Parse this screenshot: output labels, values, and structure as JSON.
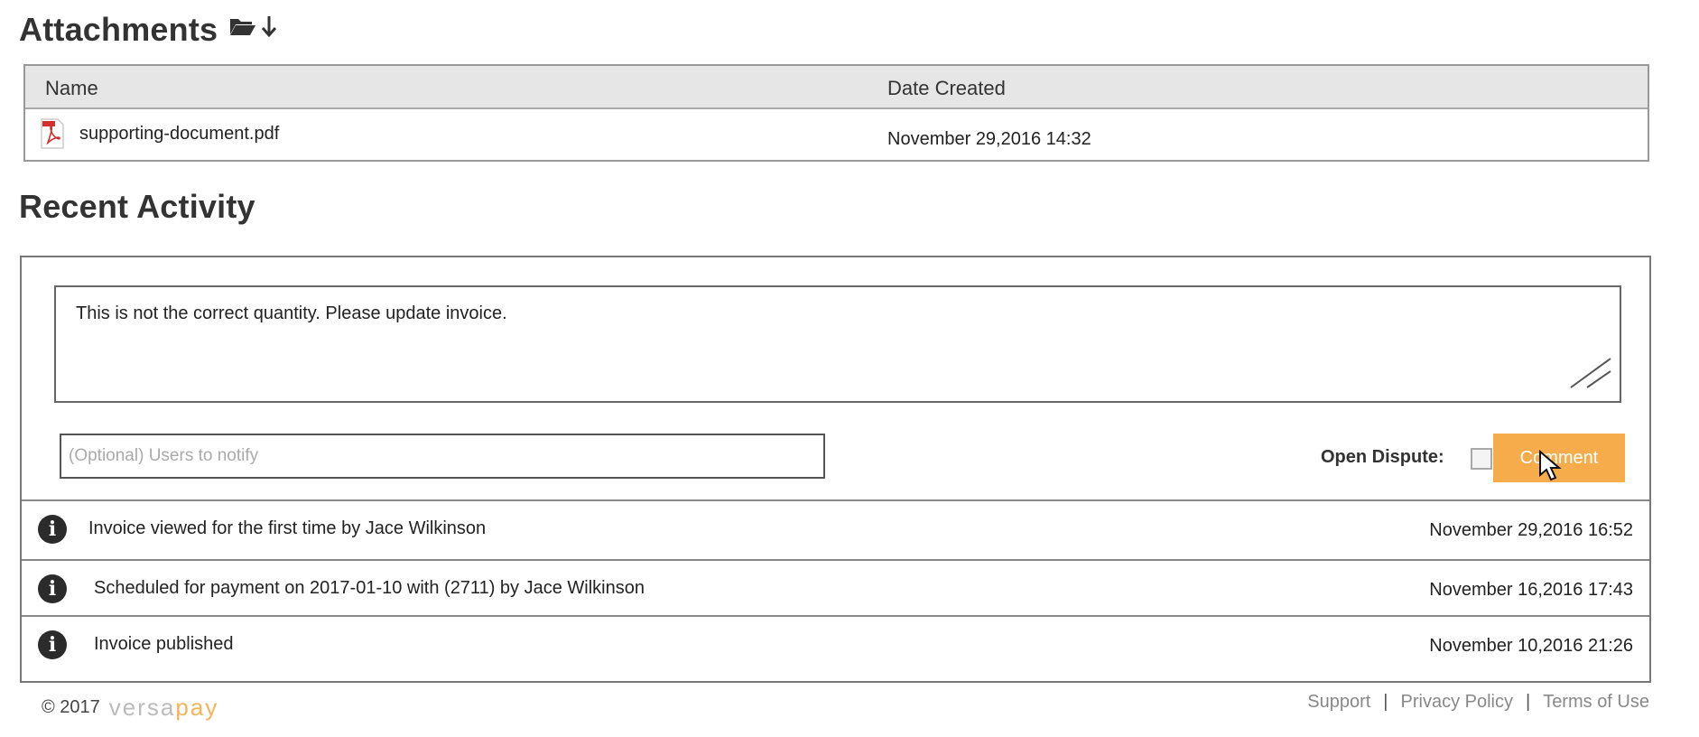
{
  "attachments": {
    "title": "Attachments",
    "columns": {
      "name": "Name",
      "date": "Date Created"
    },
    "files": [
      {
        "name": "supporting-document.pdf",
        "date": "November 29,2016  14:32"
      }
    ]
  },
  "recent_activity": {
    "title": "Recent Activity",
    "comment_text": "This is not the correct quantity. Please update invoice.",
    "notify_placeholder": "(Optional) Users to notify",
    "open_dispute_label": "Open Dispute:",
    "comment_button_label": "Comment",
    "items": [
      {
        "text": "Invoice viewed for the first time by Jace Wilkinson",
        "time": "November 29,2016 16:52"
      },
      {
        "text": "Scheduled for payment on 2017-01-10 with (2711) by Jace Wilkinson",
        "time": "November 16,2016   17:43"
      },
      {
        "text": "Invoice published",
        "time": "November 10,2016 21:26"
      }
    ]
  },
  "footer": {
    "copyright": "© 2017",
    "brand_main": "versa",
    "brand_accent": "pay",
    "links": [
      "Support",
      "Privacy Policy",
      "Terms of Use"
    ]
  },
  "colors": {
    "accent": "#f7ac4c",
    "info_icon": "#2b2b2b",
    "header_bg": "#e6e6e6"
  },
  "icons": [
    "folder-open-icon",
    "download-arrow-icon",
    "pdf-file-icon",
    "resize-grip-icon",
    "info-icon",
    "mouse-cursor-icon"
  ]
}
